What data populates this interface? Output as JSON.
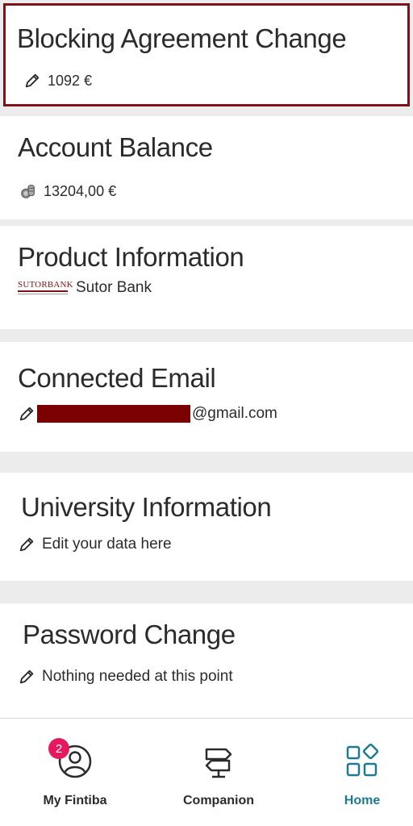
{
  "cards": {
    "blocking": {
      "title": "Blocking Agreement Change",
      "value": "1092 €"
    },
    "balance": {
      "title": "Account Balance",
      "value": "13204,00 €"
    },
    "product": {
      "title": "Product Information",
      "logo_text": "SUTORBANK",
      "value": "Sutor Bank"
    },
    "email": {
      "title": "Connected Email",
      "value_suffix": "@gmail.com"
    },
    "university": {
      "title": "University Information",
      "value": "Edit your data here"
    },
    "password": {
      "title": "Password Change",
      "value": "Nothing needed at this point"
    }
  },
  "nav": {
    "items": [
      {
        "label": "My Fintiba",
        "icon": "user-icon",
        "badge": "2"
      },
      {
        "label": "Companion",
        "icon": "signpost-icon"
      },
      {
        "label": "Home",
        "icon": "home-grid-icon",
        "active": true
      }
    ]
  },
  "colors": {
    "accent": "#1e7a91",
    "highlight_border": "#7e1218",
    "badge": "#e6195f",
    "redaction": "#7b0000"
  }
}
